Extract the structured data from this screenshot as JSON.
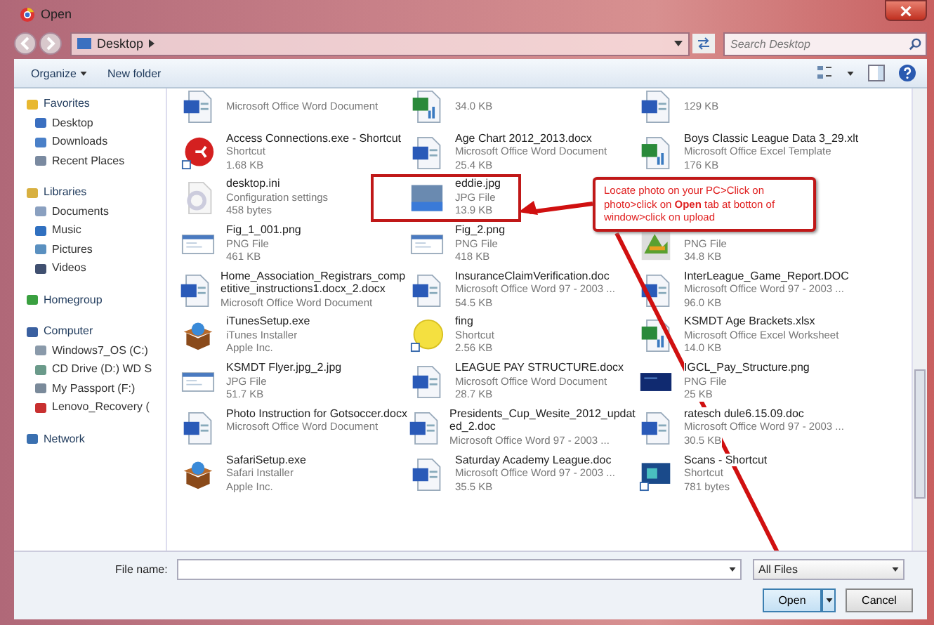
{
  "window": {
    "title": "Open"
  },
  "address_bar": {
    "location": "Desktop",
    "search_placeholder": "Search Desktop"
  },
  "toolbar": {
    "buttons": [
      "Organize",
      "New folder"
    ]
  },
  "sidebar": {
    "groups": [
      {
        "label": "Favorites",
        "kind": "star",
        "children": [
          {
            "label": "Desktop",
            "kind": "desktop"
          },
          {
            "label": "Downloads",
            "kind": "downloads"
          },
          {
            "label": "Recent Places",
            "kind": "recent"
          }
        ]
      },
      {
        "label": "Libraries",
        "kind": "library",
        "children": [
          {
            "label": "Documents",
            "kind": "documents"
          },
          {
            "label": "Music",
            "kind": "music"
          },
          {
            "label": "Pictures",
            "kind": "pictures"
          },
          {
            "label": "Videos",
            "kind": "videos"
          }
        ]
      },
      {
        "label": "Homegroup",
        "kind": "homegroup"
      },
      {
        "label": "Computer",
        "kind": "computer",
        "children": [
          {
            "label": "Windows7_OS (C:)",
            "kind": "drive"
          },
          {
            "label": "CD Drive (D:) WD S",
            "kind": "cd"
          },
          {
            "label": "My Passport (F:)",
            "kind": "usb"
          },
          {
            "label": "Lenovo_Recovery (",
            "kind": "recovery"
          }
        ]
      },
      {
        "label": "Network",
        "kind": "network"
      }
    ]
  },
  "files": [
    {
      "kind": "word",
      "lines": [
        "Microsoft Office Word Document"
      ]
    },
    {
      "kind": "excel",
      "lines": [
        "34.0 KB"
      ]
    },
    {
      "kind": "word",
      "lines": [
        "129 KB"
      ]
    },
    {
      "kind": "shortcut",
      "name": "Access Connections.exe - Shortcut",
      "lines": [
        "Shortcut",
        "1.68 KB"
      ]
    },
    {
      "kind": "word",
      "name": "Age Chart 2012_2013.docx",
      "lines": [
        "Microsoft Office Word Document",
        "25.4 KB"
      ]
    },
    {
      "kind": "excel",
      "name": "Boys Classic League Data 3_29.xlt",
      "lines": [
        "Microsoft Office Excel Template",
        "176 KB"
      ]
    },
    {
      "kind": "settings",
      "name": "desktop.ini",
      "lines": [
        "Configuration settings",
        "458 bytes"
      ]
    },
    {
      "kind": "photo",
      "name": "eddie.jpg",
      "lines": [
        "JPG File",
        "13.9 KB"
      ]
    },
    {
      "kind": "none"
    },
    {
      "kind": "image",
      "name": "Fig_1_001.png",
      "lines": [
        "PNG File",
        "461 KB"
      ]
    },
    {
      "kind": "image",
      "name": "Fig_2.png",
      "lines": [
        "PNG File",
        "418 KB"
      ]
    },
    {
      "kind": "chart",
      "lines": [
        "PNG File",
        "34.8 KB"
      ]
    },
    {
      "kind": "word",
      "name": "Home_Association_Registrars_competitive_instructions1.docx_2.docx",
      "lines": [
        "Microsoft Office Word Document"
      ]
    },
    {
      "kind": "word",
      "name": "InsuranceClaimVerification.doc",
      "lines": [
        "Microsoft Office Word 97 - 2003 ...",
        "54.5 KB"
      ]
    },
    {
      "kind": "word",
      "name": "InterLeague_Game_Report.DOC",
      "lines": [
        "Microsoft Office Word 97 - 2003 ...",
        "96.0 KB"
      ]
    },
    {
      "kind": "installer",
      "name": "iTunesSetup.exe",
      "lines": [
        "iTunes Installer",
        "Apple Inc."
      ]
    },
    {
      "kind": "ball",
      "name": "fing",
      "lines": [
        "Shortcut",
        "2.56 KB"
      ]
    },
    {
      "kind": "excel",
      "name": "KSMDT Age Brackets.xlsx",
      "lines": [
        "Microsoft Office Excel Worksheet",
        "14.0 KB"
      ]
    },
    {
      "kind": "image",
      "name": "KSMDT Flyer.jpg_2.jpg",
      "lines": [
        "JPG File",
        "51.7 KB"
      ]
    },
    {
      "kind": "word",
      "name": "LEAGUE PAY STRUCTURE.docx",
      "lines": [
        "Microsoft Office Word Document",
        "28.7 KB"
      ]
    },
    {
      "kind": "screen",
      "name": "IGCL_Pay_Structure.png",
      "lines": [
        "PNG File",
        "25 KB"
      ]
    },
    {
      "kind": "word",
      "name": "Photo Instruction for Gotsoccer.docx",
      "lines": [
        "Microsoft Office Word Document"
      ]
    },
    {
      "kind": "word",
      "name": "Presidents_Cup_Wesite_2012_updated_2.doc",
      "lines": [
        "Microsoft Office Word 97 - 2003 ..."
      ]
    },
    {
      "kind": "word",
      "name": "ratesch dule6.15.09.doc",
      "lines": [
        "Microsoft Office Word 97 - 2003 ...",
        "30.5 KB"
      ]
    },
    {
      "kind": "installer",
      "name": "SafariSetup.exe",
      "lines": [
        "Safari Installer",
        "Apple Inc."
      ]
    },
    {
      "kind": "word",
      "name": "Saturday Academy League.doc",
      "lines": [
        "Microsoft Office Word 97 - 2003 ...",
        "35.5 KB"
      ]
    },
    {
      "kind": "folder",
      "name": "Scans - Shortcut",
      "lines": [
        "Shortcut",
        "781 bytes"
      ]
    }
  ],
  "callout": {
    "text": "Locate photo on your PC>Click on photo>click on **Open** tab at botton of window>click on upload"
  },
  "bottom": {
    "file_name_label": "File name:",
    "file_type": "All Files",
    "buttons": [
      "Open",
      "Cancel"
    ]
  }
}
